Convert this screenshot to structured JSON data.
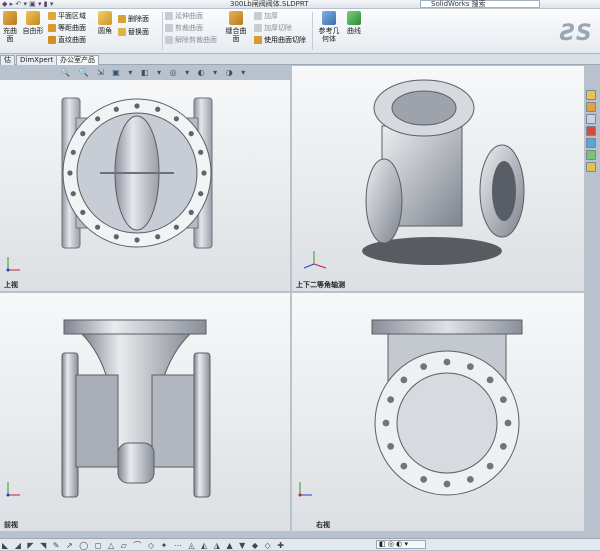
{
  "window": {
    "title": "300Lb闸阀阀体.SLDPRT",
    "search_placeholder": "SolidWorks 搜索"
  },
  "ribbon": {
    "big1": "充曲面",
    "big2": "自由形",
    "col1": [
      "平面区域",
      "等距曲面",
      "直纹曲面"
    ],
    "big3": "圆角",
    "col2": [
      "删除面",
      "替换面"
    ],
    "col3": [
      "延伸曲面",
      "剪裁曲面",
      "解除剪裁曲面"
    ],
    "big4_l1": "缝合曲",
    "big4_l2": "面",
    "col4": [
      "加厚",
      "加厚切除",
      "使用曲面切除"
    ],
    "big5_l1": "参考几",
    "big5_l2": "何体",
    "big6": "曲线"
  },
  "tabs": [
    "估",
    "DimXpert",
    "办公室产品"
  ],
  "viewports": {
    "top_left": "上视",
    "top_right": "上下二等角轴测",
    "bottom_left": "前视",
    "bottom_right": "右视"
  },
  "colors": {
    "part": "#c3c6cf",
    "part_dark": "#7d818c",
    "bg": "#eef0f2"
  }
}
